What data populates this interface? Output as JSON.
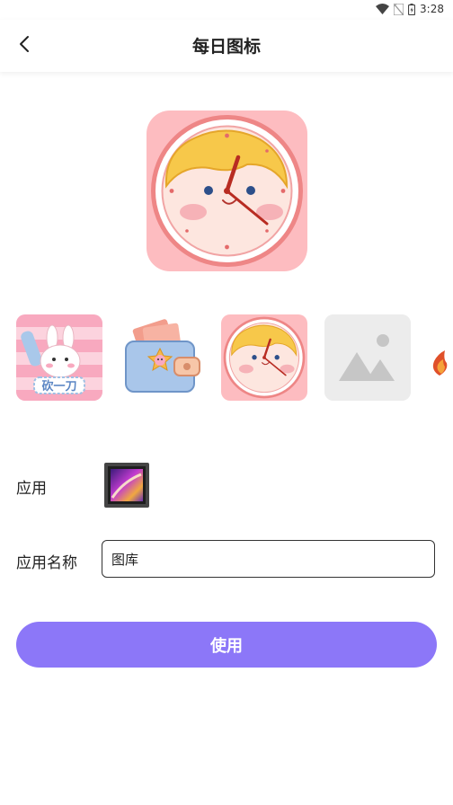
{
  "status_bar": {
    "time": "3:28"
  },
  "header": {
    "title": "每日图标"
  },
  "preview": {
    "icon": "clock-face-icon"
  },
  "icon_options": [
    {
      "icon": "bunny-icon",
      "caption": "砍一刀"
    },
    {
      "icon": "wallet-icon"
    },
    {
      "icon": "clock-face-icon",
      "selected": true
    },
    {
      "icon": "image-placeholder-icon"
    },
    {
      "icon": "flame-icon"
    }
  ],
  "app_row": {
    "label": "应用",
    "icon": "gallery-app-icon"
  },
  "name_row": {
    "label": "应用名称",
    "value": "图库"
  },
  "action": {
    "use_label": "使用"
  },
  "colors": {
    "accent": "#8c77f8",
    "preview_bg": "#fdbcc0"
  }
}
